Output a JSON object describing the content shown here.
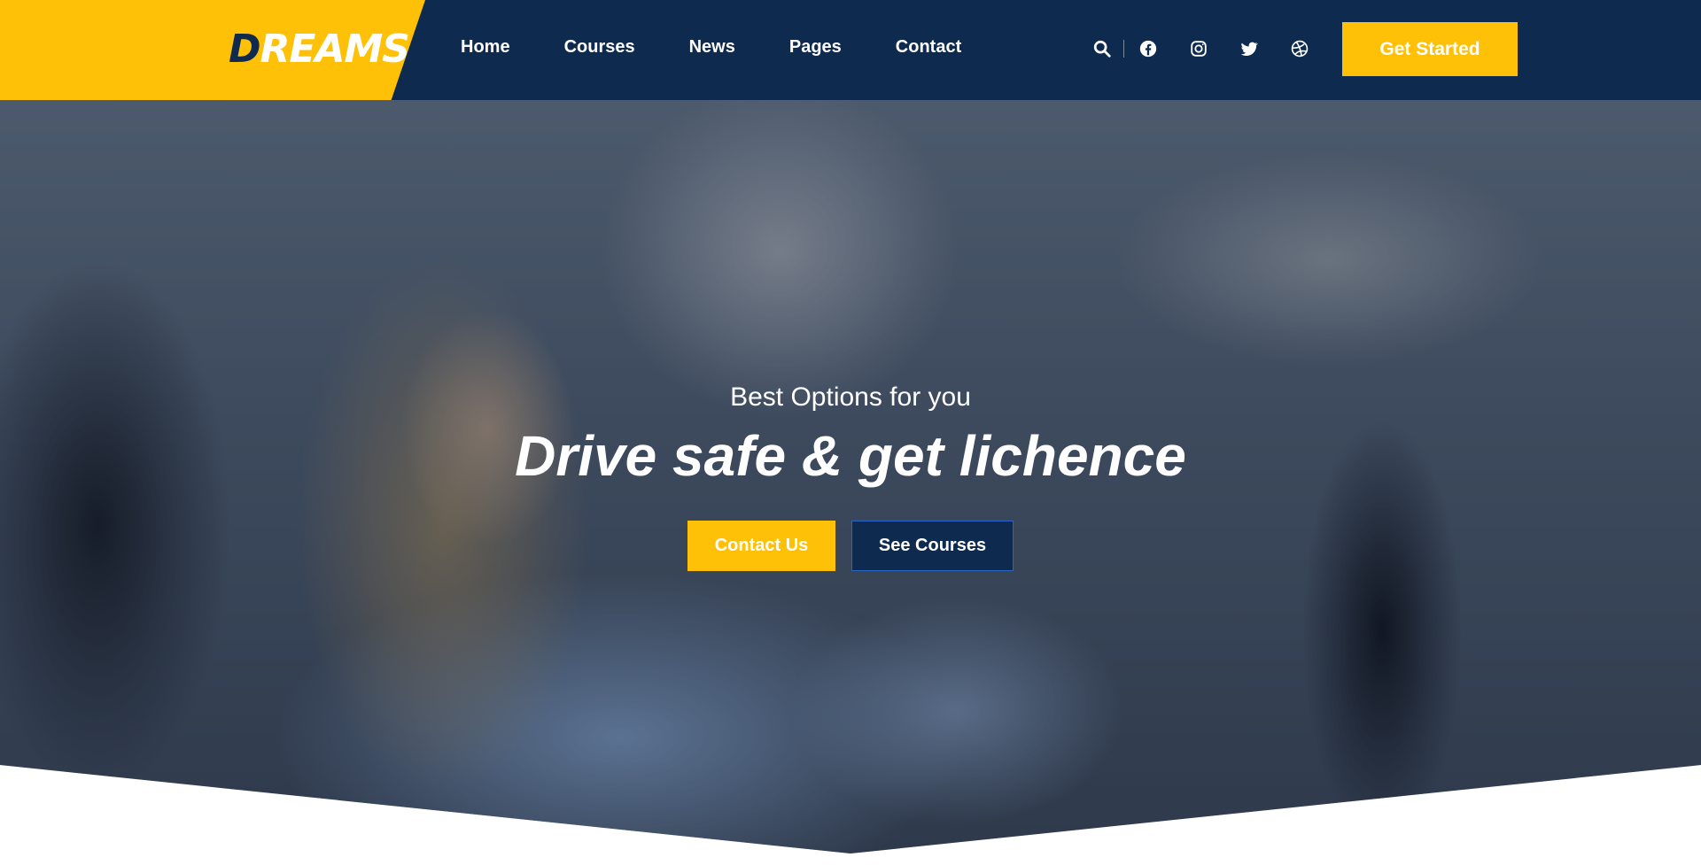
{
  "brand": {
    "logo_first": "D",
    "logo_rest": "REAMS",
    "primary_color": "#0e2a4e",
    "accent_color": "#ffc107"
  },
  "nav": {
    "items": [
      {
        "label": "Home"
      },
      {
        "label": "Courses"
      },
      {
        "label": "News"
      },
      {
        "label": "Pages"
      },
      {
        "label": "Contact"
      }
    ]
  },
  "header_icons": [
    "search-icon",
    "facebook-icon",
    "instagram-icon",
    "twitter-icon",
    "dribbble-icon"
  ],
  "header": {
    "cta_label": "Get Started"
  },
  "hero": {
    "subtitle": "Best Options for you",
    "title": "Drive safe & get lichence",
    "primary_button": "Contact Us",
    "secondary_button": "See Courses"
  }
}
